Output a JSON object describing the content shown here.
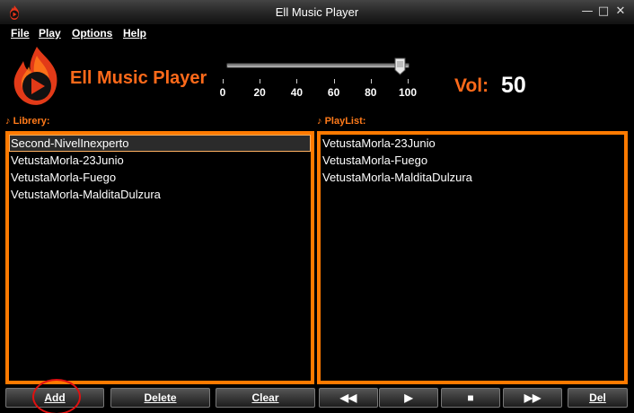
{
  "window": {
    "title": "Ell Music Player",
    "controls": {
      "minimize": "—",
      "maximize": "□",
      "close": "✕"
    }
  },
  "menu": [
    {
      "label": "File"
    },
    {
      "label": "Play"
    },
    {
      "label": "Options"
    },
    {
      "label": "Help"
    }
  ],
  "header": {
    "app_name": "Ell Music Player",
    "volume_label": "Vol:",
    "volume_value": "50",
    "volume_level": 50,
    "slider_ticks": [
      "0",
      "20",
      "40",
      "60",
      "80",
      "100"
    ]
  },
  "library": {
    "label": "Librery:",
    "items": [
      "Second-NivelInexperto",
      "VetustaMorla-23Junio",
      "VetustaMorla-Fuego",
      "VetustaMorla-MalditaDulzura"
    ],
    "selected_index": 0
  },
  "playlist": {
    "label": "PlayList:",
    "items": [
      "VetustaMorla-23Junio",
      "VetustaMorla-Fuego",
      "VetustaMorla-MalditaDulzura"
    ]
  },
  "buttons": {
    "add": "Add",
    "delete": "Delete",
    "clear": "Clear",
    "prev": "◀◀",
    "play": "▶",
    "stop": "■",
    "next": "▶▶",
    "del": "Del"
  },
  "colors": {
    "accent": "#ff7a00",
    "title_orange": "#ff6a1a",
    "annotation": "#e01010"
  },
  "icons": {
    "music_note": "♪"
  }
}
